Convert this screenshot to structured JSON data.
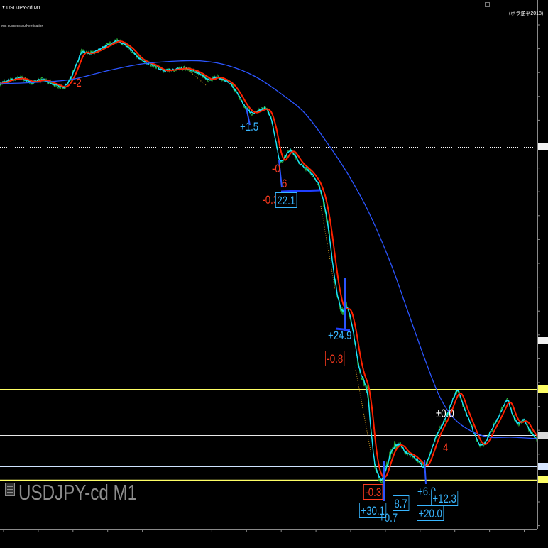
{
  "window": {
    "symbol_title": "USDJPY-cd,M1",
    "auth_message": "trus success authentication",
    "indicator_name": "(ボラ逆平2018)"
  },
  "watermark": {
    "text": "USDJPY-cd M1"
  },
  "annotations": [
    {
      "text": "-2"
    },
    {
      "text": "+1.5"
    },
    {
      "text": "-0"
    },
    {
      "text": "6"
    },
    {
      "text": "-0.3"
    },
    {
      "text": "22.1"
    },
    {
      "text": "+24.9"
    },
    {
      "text": "-0.8"
    },
    {
      "text": "±0.0"
    },
    {
      "text": "4"
    },
    {
      "text": "-0.3"
    },
    {
      "text": "+30.1"
    },
    {
      "text": "+0.7"
    },
    {
      "text": "8.7"
    },
    {
      "text": "+6.0"
    },
    {
      "text": "+12.3"
    },
    {
      "text": "+20.0"
    }
  ],
  "chart_data": {
    "type": "line",
    "symbol": "USDJPY-cd",
    "timeframe": "M1",
    "series": [
      {
        "color": "#2ecc40"
      },
      {
        "color": "#19e3ff"
      },
      {
        "color": "#ff2200"
      },
      {
        "color": "#2b55ff"
      }
    ],
    "grid": false
  },
  "colors": {
    "background": "#000000",
    "price_green": "#2ecc40",
    "price_cyan": "#19e3ff",
    "signal_red": "#ff2200",
    "moving_average_blue": "#2b55ff",
    "positive_label": "#38b6ff",
    "negative_label": "#ff3b1f",
    "level_yellow": "#ffff66",
    "level_white": "#ffffff"
  }
}
